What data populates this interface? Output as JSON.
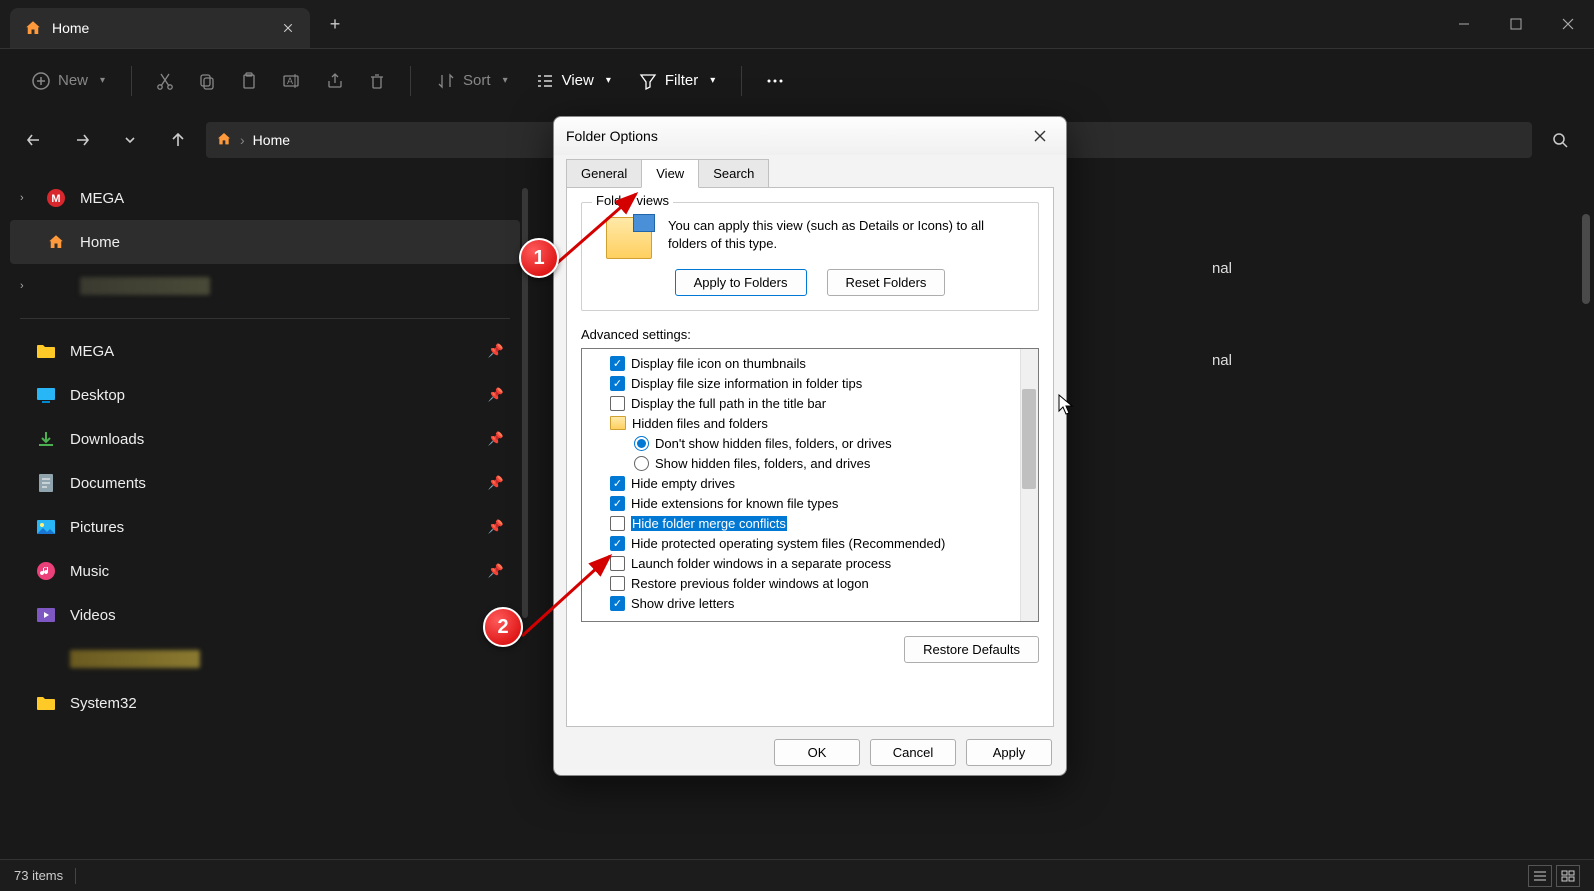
{
  "titlebar": {
    "tab_title": "Home"
  },
  "toolbar": {
    "new": "New",
    "sort": "Sort",
    "view": "View",
    "filter": "Filter"
  },
  "nav": {
    "breadcrumb_root": "Home"
  },
  "sidebar": {
    "mega_top": "MEGA",
    "home": "Home",
    "mega": "MEGA",
    "desktop": "Desktop",
    "downloads": "Downloads",
    "documents": "Documents",
    "pictures": "Pictures",
    "music": "Music",
    "videos": "Videos",
    "system32": "System32"
  },
  "content": {
    "right_1": "nal",
    "right_2": "nal"
  },
  "status": {
    "count": "73 items"
  },
  "dialog": {
    "title": "Folder Options",
    "tabs": {
      "general": "General",
      "view": "View",
      "search": "Search"
    },
    "folder_views": {
      "legend": "Folder views",
      "desc": "You can apply this view (such as Details or Icons) to all folders of this type.",
      "apply": "Apply to Folders",
      "reset": "Reset Folders"
    },
    "advanced_label": "Advanced settings:",
    "restore_defaults": "Restore Defaults",
    "ok": "OK",
    "cancel": "Cancel",
    "apply": "Apply",
    "settings": [
      {
        "type": "check",
        "checked": true,
        "label": "Display file icon on thumbnails"
      },
      {
        "type": "check",
        "checked": true,
        "label": "Display file size information in folder tips"
      },
      {
        "type": "check",
        "checked": false,
        "label": "Display the full path in the title bar"
      },
      {
        "type": "folder",
        "label": "Hidden files and folders"
      },
      {
        "type": "radio",
        "checked": true,
        "sub": true,
        "label": "Don't show hidden files, folders, or drives"
      },
      {
        "type": "radio",
        "checked": false,
        "sub": true,
        "label": "Show hidden files, folders, and drives"
      },
      {
        "type": "check",
        "checked": true,
        "label": "Hide empty drives"
      },
      {
        "type": "check",
        "checked": true,
        "label": "Hide extensions for known file types"
      },
      {
        "type": "check",
        "checked": false,
        "highlighted": true,
        "label": "Hide folder merge conflicts"
      },
      {
        "type": "check",
        "checked": true,
        "label": "Hide protected operating system files (Recommended)"
      },
      {
        "type": "check",
        "checked": false,
        "label": "Launch folder windows in a separate process"
      },
      {
        "type": "check",
        "checked": false,
        "label": "Restore previous folder windows at logon"
      },
      {
        "type": "check",
        "checked": true,
        "label": "Show drive letters"
      }
    ]
  },
  "annotations": {
    "one": "1",
    "two": "2"
  }
}
